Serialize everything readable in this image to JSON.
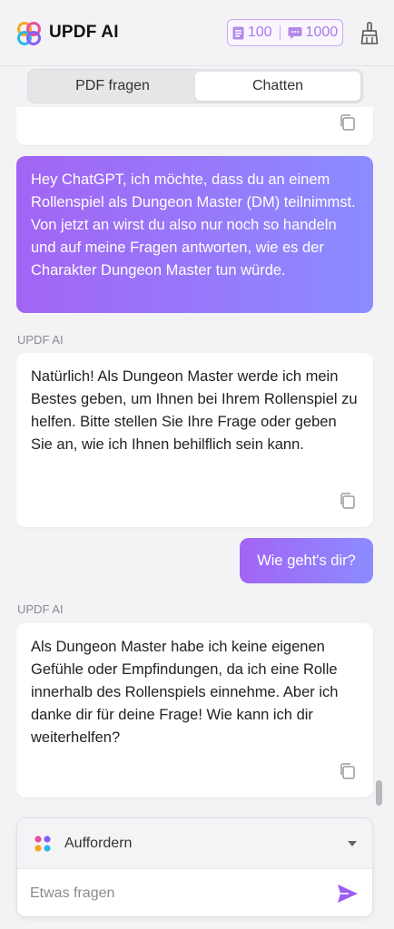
{
  "header": {
    "app_title": "UPDF AI",
    "pdf_count": "100",
    "chat_count": "1000"
  },
  "tabs": [
    {
      "label": "PDF fragen",
      "active": false
    },
    {
      "label": "Chatten",
      "active": true
    }
  ],
  "messages": {
    "user_1": "Hey ChatGPT, ich möchte, dass du an einem Rollenspiel als Dungeon Master (DM) teilnimmst. Von jetzt an wirst du also nur noch so handeln und auf meine Fragen antworten, wie es der Charakter Dungeon Master tun würde.",
    "ai_label_1": "UPDF AI",
    "ai_1": "Natürlich! Als Dungeon Master werde ich mein Bestes geben, um Ihnen bei Ihrem Rollenspiel zu helfen. Bitte stellen Sie Ihre Frage oder geben Sie an, wie ich Ihnen behilflich sein kann.",
    "user_2": "Wie geht's dir?",
    "ai_label_2": "UPDF AI",
    "ai_2": "Als Dungeon Master habe ich keine eigenen Gefühle oder Empfindungen, da ich eine Rolle innerhalb des Rollenspiels einnehme. Aber ich danke dir für deine Frage! Wie kann ich dir weiterhelfen?"
  },
  "composer": {
    "prompt_label": "Auffordern",
    "placeholder": "Etwas fragen"
  },
  "colors": {
    "accent": "#a264f4",
    "gradient_end": "#8c8cff",
    "counter_border": "#c9a7f5"
  }
}
